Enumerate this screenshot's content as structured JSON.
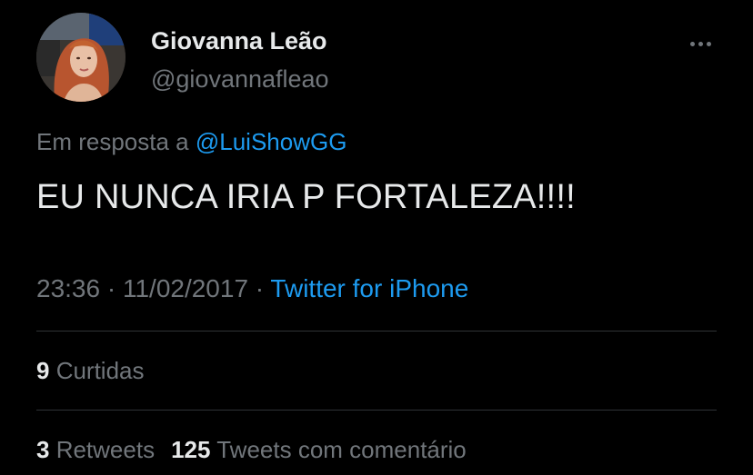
{
  "author": {
    "display_name": "Giovanna Leão",
    "handle": "@giovannafleao"
  },
  "reply": {
    "prefix": "Em resposta a ",
    "mention": "@LuiShowGG"
  },
  "tweet": {
    "text": "EU NUNCA IRIA P FORTALEZA!!!!"
  },
  "meta": {
    "time": "23:36",
    "sep1": " · ",
    "date": "11/02/2017",
    "sep2": " · ",
    "source": "Twitter for iPhone"
  },
  "stats": {
    "likes_count": "9",
    "likes_label": " Curtidas",
    "retweets_count": "3",
    "retweets_label": " Retweets",
    "quotes_count": "125",
    "quotes_label": " Tweets com comentário"
  },
  "icons": {
    "more": "more-horizontal-icon"
  },
  "colors": {
    "background": "#000000",
    "primary_text": "#e7e9ea",
    "secondary_text": "#71767b",
    "link": "#1d9bf0",
    "divider": "#2f3336"
  }
}
